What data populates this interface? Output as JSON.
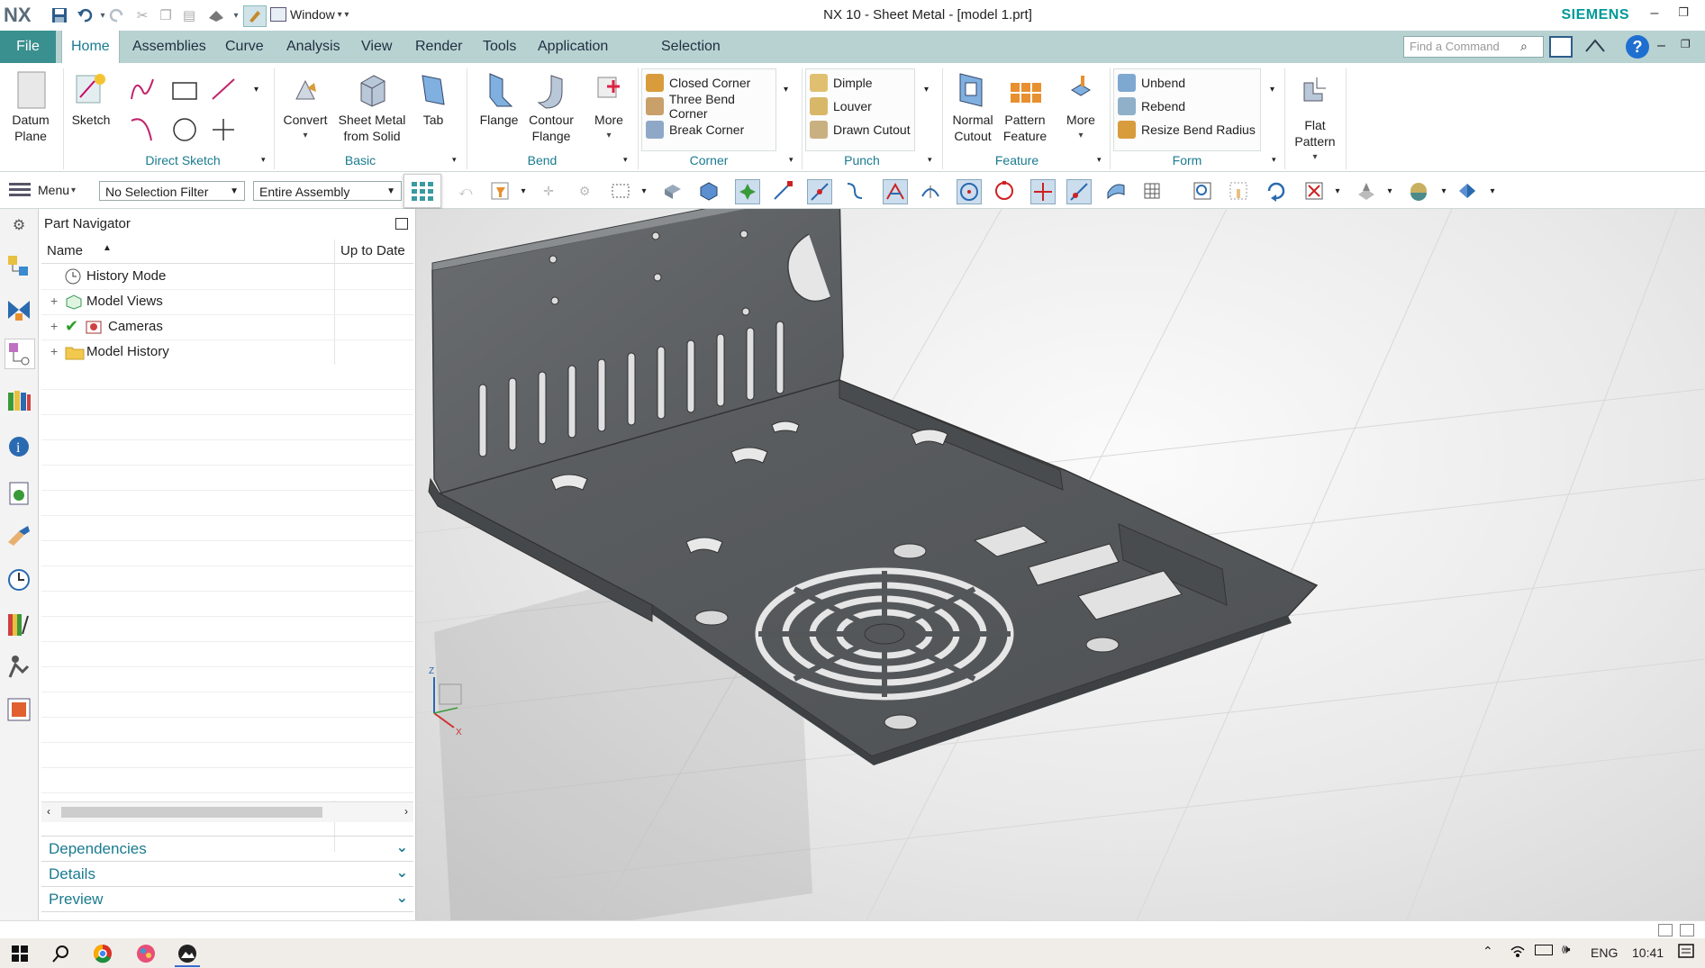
{
  "app": {
    "logo": "NX",
    "title": "NX 10 - Sheet Metal - [model 1.prt]",
    "brand": "SIEMENS",
    "window_menu": "Window",
    "accent_color": "#3a8f8f",
    "brand_color": "#009999"
  },
  "tabs": [
    "File",
    "Home",
    "Assemblies",
    "Curve",
    "Analysis",
    "View",
    "Render",
    "Tools",
    "Application",
    "Selection"
  ],
  "find_command_placeholder": "Find a Command",
  "ribbon": {
    "datum_plane": "Datum Plane",
    "sketch": "Sketch",
    "convert": "Convert",
    "sheet_metal_from_solid": "Sheet Metal from Solid",
    "tab": "Tab",
    "flange": "Flange",
    "contour_flange": "Contour Flange",
    "more_bend": "More",
    "closed_corner": "Closed Corner",
    "three_bend_corner": "Three Bend Corner",
    "break_corner": "Break Corner",
    "dimple": "Dimple",
    "louver": "Louver",
    "drawn_cutout": "Drawn Cutout",
    "normal_cutout": "Normal Cutout",
    "pattern_feature": "Pattern Feature",
    "more_feature": "More",
    "unbend": "Unbend",
    "rebend": "Rebend",
    "resize_bend_radius": "Resize Bend Radius",
    "flat_pattern": "Flat Pattern",
    "groups": {
      "direct_sketch": "Direct Sketch",
      "basic": "Basic",
      "bend": "Bend",
      "corner": "Corner",
      "punch": "Punch",
      "feature": "Feature",
      "form": "Form"
    }
  },
  "toolbar": {
    "menu": "Menu",
    "selection_filter": "No Selection Filter",
    "scope": "Entire Assembly"
  },
  "navigator": {
    "title": "Part Navigator",
    "col_name": "Name",
    "col_uptodate": "Up to Date",
    "items": [
      "History Mode",
      "Model Views",
      "Cameras",
      "Model History"
    ],
    "panels": [
      "Dependencies",
      "Details",
      "Preview"
    ]
  },
  "taskbar": {
    "language": "ENG",
    "time": "10:41"
  }
}
